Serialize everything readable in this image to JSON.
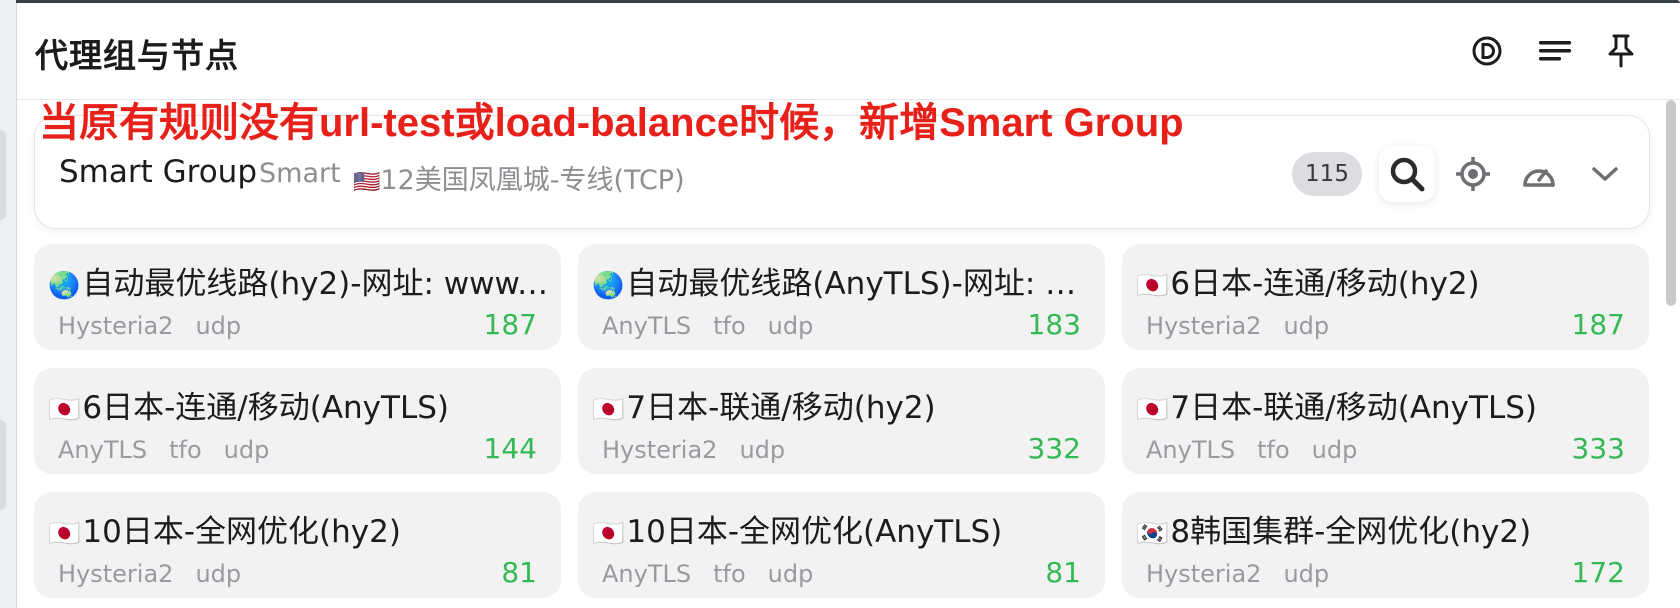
{
  "header": {
    "title": "代理组与节点"
  },
  "annotation": {
    "text_parts": [
      "当原有规则没有",
      "url-test",
      "或",
      "load-balance",
      "时候，新增",
      "Smart Group"
    ]
  },
  "group": {
    "name": "Smart Group",
    "type": "Smart",
    "now_flag": "🇺🇸",
    "now": "12美国凤凰城-专线(TCP)",
    "count": "115"
  },
  "nodes": [
    {
      "flag": "🌏",
      "name": "自动最优线路(hy2)-网址: www.…",
      "tags": [
        "Hysteria2",
        "udp"
      ],
      "delay": "187"
    },
    {
      "flag": "🌏",
      "name": "自动最优线路(AnyTLS)-网址: w…",
      "tags": [
        "AnyTLS",
        "tfo",
        "udp"
      ],
      "delay": "183"
    },
    {
      "flag": "🇯🇵",
      "name": "6日本-连通/移动(hy2)",
      "tags": [
        "Hysteria2",
        "udp"
      ],
      "delay": "187"
    },
    {
      "flag": "🇯🇵",
      "name": "6日本-连通/移动(AnyTLS)",
      "tags": [
        "AnyTLS",
        "tfo",
        "udp"
      ],
      "delay": "144"
    },
    {
      "flag": "🇯🇵",
      "name": "7日本-联通/移动(hy2)",
      "tags": [
        "Hysteria2",
        "udp"
      ],
      "delay": "332"
    },
    {
      "flag": "🇯🇵",
      "name": "7日本-联通/移动(AnyTLS)",
      "tags": [
        "AnyTLS",
        "tfo",
        "udp"
      ],
      "delay": "333"
    },
    {
      "flag": "🇯🇵",
      "name": "10日本-全网优化(hy2)",
      "tags": [
        "Hysteria2",
        "udp"
      ],
      "delay": "81"
    },
    {
      "flag": "🇯🇵",
      "name": "10日本-全网优化(AnyTLS)",
      "tags": [
        "AnyTLS",
        "tfo",
        "udp"
      ],
      "delay": "81"
    },
    {
      "flag": "🇰🇷",
      "name": "8韩国集群-全网优化(hy2)",
      "tags": [
        "Hysteria2",
        "udp"
      ],
      "delay": "172"
    }
  ],
  "colors": {
    "accent_red": "#e8201a",
    "delay_green": "#34b954",
    "card_bg": "#f2f2f3"
  },
  "icons": [
    "d-circle-icon",
    "sort-lines-icon",
    "pin-icon",
    "search-icon",
    "locate-icon",
    "speedometer-icon",
    "chevron-down-icon"
  ]
}
